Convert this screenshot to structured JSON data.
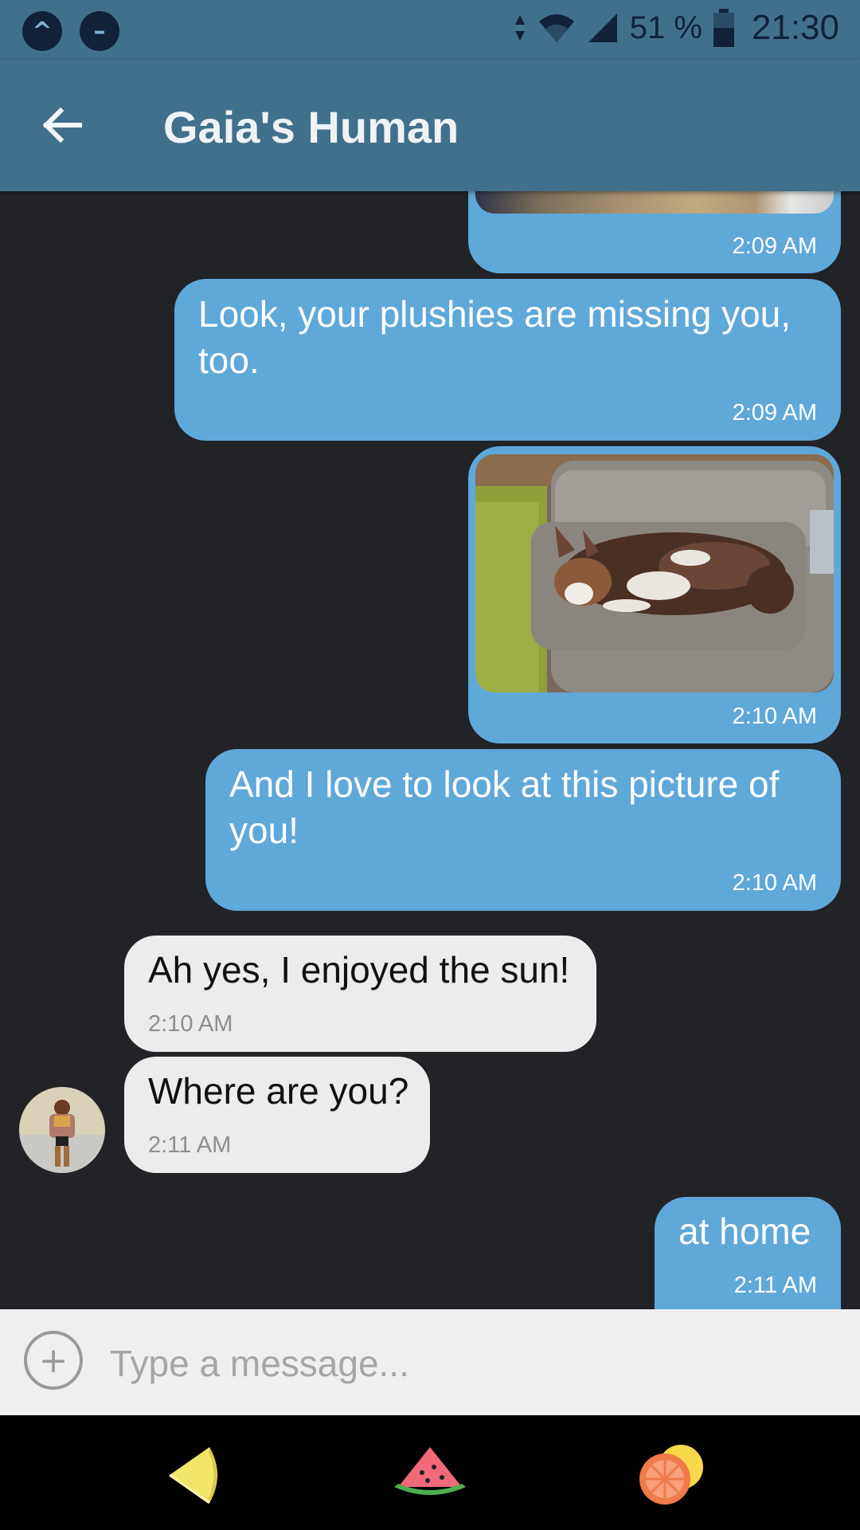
{
  "status_bar": {
    "battery_percent": "51 %",
    "time": "21:30"
  },
  "header": {
    "title": "Gaia's Human"
  },
  "messages": [
    {
      "direction": "outgoing",
      "type": "photo",
      "time": "2:09 AM"
    },
    {
      "direction": "outgoing",
      "type": "text",
      "text_line1": "Look, your plushies are missing you,",
      "text_line2": "too.",
      "time": "2:09 AM"
    },
    {
      "direction": "outgoing",
      "type": "photo",
      "time": "2:10 AM"
    },
    {
      "direction": "outgoing",
      "type": "text",
      "text_line1": "And I love to look at this picture of",
      "text_line2": "you!",
      "time": "2:10 AM"
    },
    {
      "direction": "incoming",
      "type": "text",
      "text": "Ah yes, I enjoyed the sun!",
      "time": "2:10 AM"
    },
    {
      "direction": "incoming",
      "type": "text",
      "text": "Where are you?",
      "time": "2:11 AM"
    },
    {
      "direction": "outgoing",
      "type": "text",
      "text": "at home",
      "time": "2:11 AM"
    }
  ],
  "composer": {
    "placeholder": "Type a message..."
  },
  "colors": {
    "header": "#41708d",
    "outgoing_bubble": "#5fa8da",
    "incoming_bubble": "#ececec",
    "background": "#212327"
  },
  "icons": [
    "app-icon",
    "dnd-icon",
    "wifi-icon",
    "signal-icon",
    "battery-icon",
    "back-arrow-icon",
    "add-attachment-icon",
    "lemon-nav-icon",
    "watermelon-nav-icon",
    "citrus-nav-icon"
  ]
}
